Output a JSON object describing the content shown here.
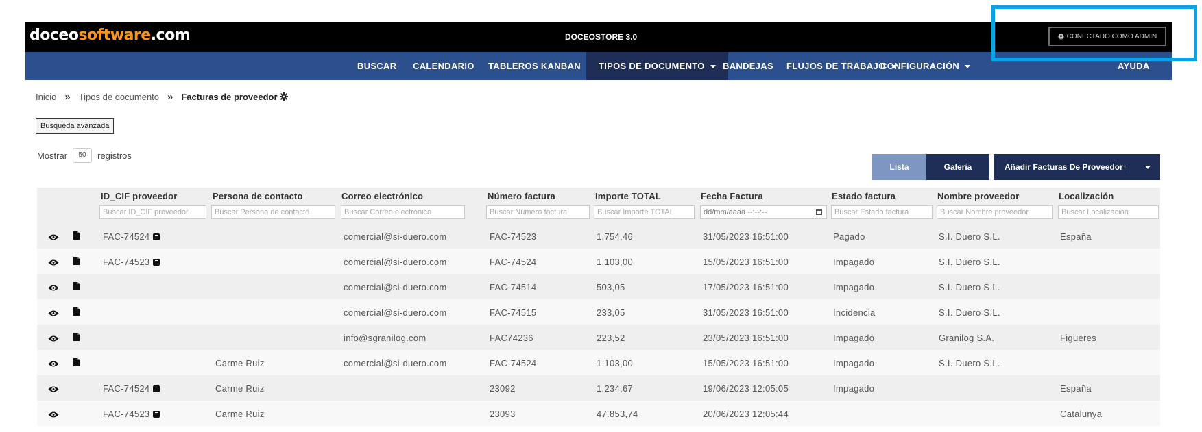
{
  "header": {
    "logo_part1": "doceo",
    "logo_part2": "software",
    "logo_part3": ".com",
    "app_title": "DOCEOSTORE 3.0",
    "connection_label": "CONECTADO COMO ADMIN"
  },
  "nav": {
    "items": [
      {
        "label": "BUSCAR"
      },
      {
        "label": "CALENDARIO"
      },
      {
        "label": "TABLEROS KANBAN"
      },
      {
        "label": "TIPOS DE DOCUMENTO"
      },
      {
        "label": "BANDEJAS"
      },
      {
        "label": "FLUJOS DE TRABAJO"
      },
      {
        "label": "CONFIGURACIÓN"
      },
      {
        "label": "AYUDA"
      }
    ]
  },
  "breadcrumb": {
    "home": "Inicio",
    "section": "Tipos de documento",
    "current": "Facturas de proveedor"
  },
  "toolbar": {
    "advanced_search": "Busqueda avanzada",
    "show_label": "Mostrar",
    "show_value": "50",
    "records_label": "registros",
    "view_list": "Lista",
    "view_gallery": "Galeria",
    "add_button": "Añadir Facturas De Proveedor↑"
  },
  "table": {
    "columns": [
      {
        "label": "ID_CIF proveedor",
        "filter": "Buscar ID_CIF proveedor"
      },
      {
        "label": "Persona de contacto",
        "filter": "Buscar Persona de contacto"
      },
      {
        "label": "Correo electrónico",
        "filter": "Buscar Correo electrónico"
      },
      {
        "label": "Número factura",
        "filter": "Buscar Número factura"
      },
      {
        "label": "Importe TOTAL",
        "filter": "Buscar Importe TOTAL"
      },
      {
        "label": "Fecha Factura",
        "filter": "dd/mm/aaaa --:--:--"
      },
      {
        "label": "Estado factura",
        "filter": "Buscar Estado factura"
      },
      {
        "label": "Nombre proveedor",
        "filter": "Buscar Nombre proveedor"
      },
      {
        "label": "Localización",
        "filter": "Buscar Localización"
      }
    ],
    "rows": [
      {
        "id": "FAC-74524",
        "contact": "",
        "email": "comercial@si-duero.com",
        "invoice": "FAC-74523",
        "total": "1.754,46",
        "date": "31/05/2023 16:51:00",
        "status": "Pagado",
        "supplier": "S.I. Duero S.L.",
        "location": "España"
      },
      {
        "id": "FAC-74523",
        "contact": "",
        "email": "comercial@si-duero.com",
        "invoice": "FAC-74524",
        "total": "1.103,00",
        "date": "15/05/2023 16:51:00",
        "status": "Impagado",
        "supplier": "S.I. Duero S.L.",
        "location": ""
      },
      {
        "id": "",
        "contact": "",
        "email": "comercial@si-duero.com",
        "invoice": "FAC-74514",
        "total": "503,05",
        "date": "17/05/2023 16:51:00",
        "status": "Impagado",
        "supplier": "S.I. Duero S.L.",
        "location": ""
      },
      {
        "id": "",
        "contact": "",
        "email": "comercial@si-duero.com",
        "invoice": "FAC-74515",
        "total": "233,05",
        "date": "31/05/2023 16:51:00",
        "status": "Incidencia",
        "supplier": "S.I. Duero S.L.",
        "location": ""
      },
      {
        "id": "",
        "contact": "",
        "email": "info@sgranilog.com",
        "invoice": "FAC74236",
        "total": "223,52",
        "date": "23/05/2023 16:51:00",
        "status": "Impagado",
        "supplier": "Granilog S.A.",
        "location": "Figueres"
      },
      {
        "id": "",
        "contact": "Carme Ruiz",
        "email": "comercial@si-duero.com",
        "invoice": "FAC-74524",
        "total": "1.103,00",
        "date": "15/05/2023 16:51:00",
        "status": "Impagado",
        "supplier": "S.I. Duero S.L.",
        "location": ""
      },
      {
        "id": "FAC-74524",
        "contact": "Carme Ruiz",
        "email": "",
        "invoice": "23092",
        "total": "1.234,67",
        "date": "19/06/2023 12:05:05",
        "status": "Impagado",
        "supplier": "",
        "location": "España"
      },
      {
        "id": "FAC-74523",
        "contact": "Carme Ruiz",
        "email": "",
        "invoice": "23093",
        "total": "47.853,74",
        "date": "20/06/2023 12:05:44",
        "status": "",
        "supplier": "",
        "location": "Catalunya"
      }
    ]
  },
  "colors": {
    "nav_bg": "#2c4f8e",
    "nav_active": "#1f2e56",
    "highlight": "#0aa3e8",
    "logo_accent": "#f7941d"
  }
}
